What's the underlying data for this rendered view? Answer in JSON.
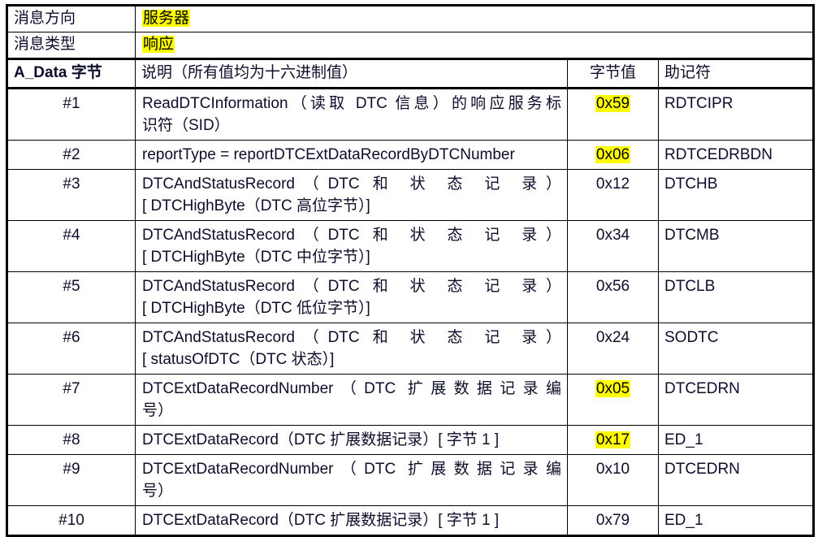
{
  "meta_rows": [
    {
      "label": "消息方向",
      "value": "服务器",
      "highlight": true
    },
    {
      "label": "消息类型",
      "value": "响应",
      "highlight": true
    }
  ],
  "header": {
    "byte": "A_Data 字节",
    "byte_prefix": "A_Data",
    "byte_suffix": " 字节",
    "description": "说明（所有值均为十六进制值）",
    "value": "字节值",
    "mnemonic": "助记符"
  },
  "colors": {
    "highlight": "#ffff00",
    "text": "#0d0d2b",
    "border": "#000000",
    "background": "#ffffff"
  },
  "rows": [
    {
      "byte": "#1",
      "desc_lines": [
        "ReadDTCInformation（读取 DTC 信息）的响应服务标",
        "识符（SID）"
      ],
      "value": "0x59",
      "highlight": true,
      "mnemonic": "RDTCIPR"
    },
    {
      "byte": "#2",
      "desc_lines": [
        "reportType = reportDTCExtDataRecordByDTCNumber"
      ],
      "value": "0x06",
      "highlight": true,
      "mnemonic": "RDTCEDRBDN"
    },
    {
      "byte": "#3",
      "desc_lines": [
        "DTCAndStatusRecord（DTC 和 状 态 记 录）",
        "[ DTCHighByte（DTC 高位字节）]"
      ],
      "value": "0x12",
      "highlight": false,
      "mnemonic": "DTCHB"
    },
    {
      "byte": "#4",
      "desc_lines": [
        "DTCAndStatusRecord（DTC 和 状 态 记 录）",
        "[ DTCHighByte（DTC 中位字节）]"
      ],
      "value": "0x34",
      "highlight": false,
      "mnemonic": "DTCMB"
    },
    {
      "byte": "#5",
      "desc_lines": [
        "DTCAndStatusRecord（DTC 和 状 态 记 录）",
        "[ DTCHighByte（DTC 低位字节）]"
      ],
      "value": "0x56",
      "highlight": false,
      "mnemonic": "DTCLB"
    },
    {
      "byte": "#6",
      "desc_lines": [
        "DTCAndStatusRecord（DTC 和 状 态 记 录）",
        "[ statusOfDTC（DTC 状态）]"
      ],
      "value": "0x24",
      "highlight": false,
      "mnemonic": "SODTC"
    },
    {
      "byte": "#7",
      "desc_lines": [
        "DTCExtDataRecordNumber（DTC 扩展数据记录编",
        "号）"
      ],
      "value": "0x05",
      "highlight": true,
      "mnemonic": "DTCEDRN"
    },
    {
      "byte": "#8",
      "desc_lines": [
        "DTCExtDataRecord（DTC 扩展数据记录）[ 字节 1 ]"
      ],
      "value": "0x17",
      "highlight": true,
      "mnemonic": "ED_1"
    },
    {
      "byte": "#9",
      "desc_lines": [
        "DTCExtDataRecordNumber（DTC 扩展数据记录编",
        "号）"
      ],
      "value": "0x10",
      "highlight": false,
      "mnemonic": "DTCEDRN"
    },
    {
      "byte": "#10",
      "desc_lines": [
        "DTCExtDataRecord（DTC 扩展数据记录）[ 字节 1 ]"
      ],
      "value": "0x79",
      "highlight": false,
      "mnemonic": "ED_1"
    }
  ]
}
